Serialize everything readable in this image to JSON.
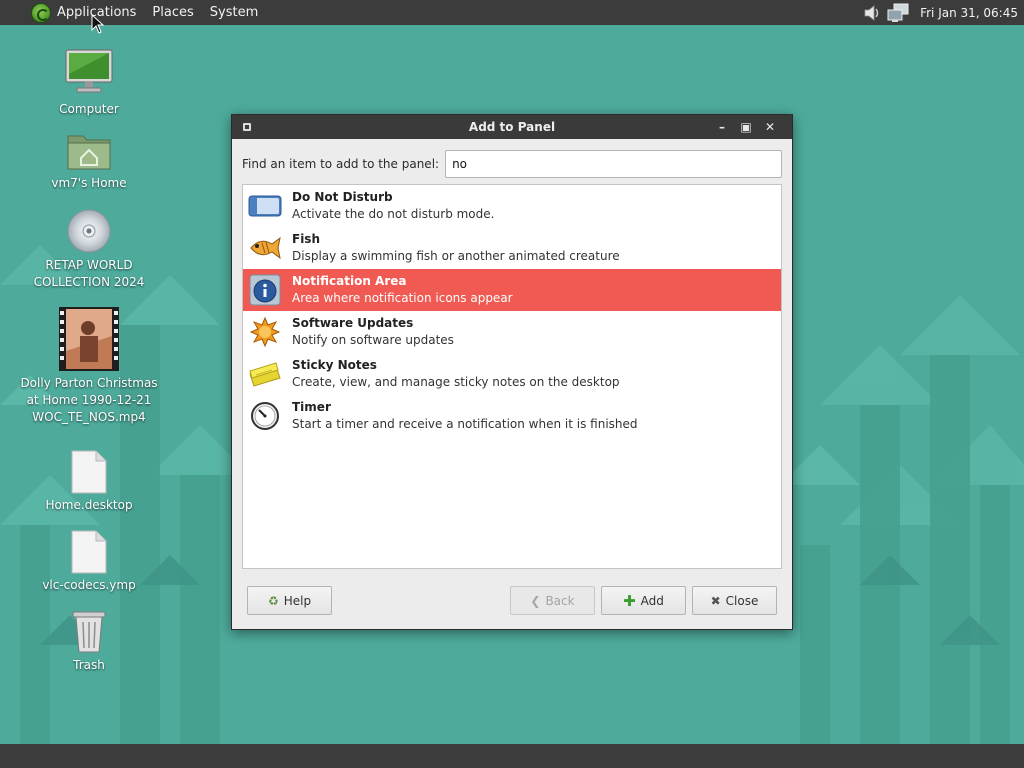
{
  "top_panel": {
    "menus": [
      "Applications",
      "Places",
      "System"
    ],
    "clock": "Fri Jan 31, 06:45"
  },
  "desktop_icons": [
    {
      "label": "Computer",
      "icon": "computer-icon"
    },
    {
      "label": "vm7's Home",
      "icon": "home-folder-icon"
    },
    {
      "label": "RETAP WORLD\nCOLLECTION 2024",
      "icon": "optical-disc-icon"
    },
    {
      "label": "Dolly Parton Christmas\nat Home 1990-12-21\nWOC_TE_NOS.mp4",
      "icon": "video-file-icon"
    },
    {
      "label": "Home.desktop",
      "icon": "document-icon"
    },
    {
      "label": "vlc-codecs.ymp",
      "icon": "document-icon"
    },
    {
      "label": "Trash",
      "icon": "trash-icon"
    }
  ],
  "dialog": {
    "title": "Add to Panel",
    "find_label": "Find an item to add to the panel:",
    "find_value": "no",
    "items": [
      {
        "title": "Do Not Disturb",
        "desc": "Activate the do not disturb mode.",
        "icon": "do-not-disturb-icon"
      },
      {
        "title": "Fish",
        "desc": "Display a swimming fish or another animated creature",
        "icon": "fish-icon"
      },
      {
        "title": "Notification Area",
        "desc": "Area where notification icons appear",
        "icon": "info-icon",
        "selected": true
      },
      {
        "title": "Software Updates",
        "desc": "Notify on software updates",
        "icon": "software-updates-icon"
      },
      {
        "title": "Sticky Notes",
        "desc": "Create, view, and manage sticky notes on the desktop",
        "icon": "sticky-notes-icon"
      },
      {
        "title": "Timer",
        "desc": "Start a timer and receive a notification when it is finished",
        "icon": "timer-icon"
      }
    ],
    "buttons": {
      "help": "Help",
      "back": "Back",
      "add": "Add",
      "close": "Close"
    }
  },
  "colors": {
    "desktop": "#4eab9c",
    "panel": "#3c3c3c",
    "selection": "#f05a52"
  }
}
